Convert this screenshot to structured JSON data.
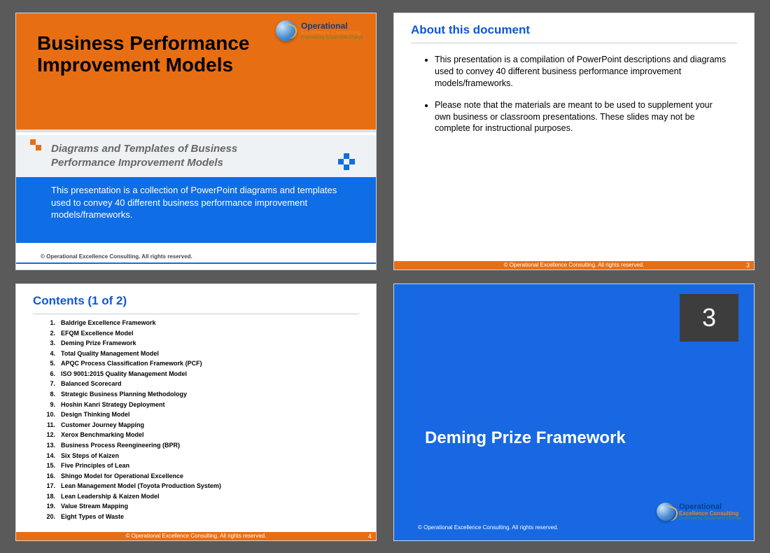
{
  "logo": {
    "line1": "Operational",
    "line2": "Excellence Consulting",
    "line3": "Empowering Sustainable Change"
  },
  "slide1": {
    "title_l1": "Business Performance",
    "title_l2": "Improvement Models",
    "subtitle": "Diagrams and Templates of Business Performance Improvement Models",
    "desc": "This presentation is a collection of PowerPoint diagrams and templates used to convey 40 different business performance improvement models/frameworks.",
    "copyright": "© Operational Excellence Consulting.  All rights reserved."
  },
  "slide2": {
    "header": "About this document",
    "bullets": [
      "This presentation is a compilation of PowerPoint descriptions and diagrams used to convey 40 different business performance improvement models/frameworks.",
      "Please note that the materials are meant to be used to supplement your own business or classroom presentations. These slides may not be complete for instructional purposes."
    ],
    "footer": "© Operational Excellence Consulting.  All rights reserved.",
    "page": "3"
  },
  "slide3": {
    "header": "Contents (1 of 2)",
    "items": [
      "Baldrige Excellence Framework",
      "EFQM Excellence Model",
      "Deming Prize Framework",
      "Total Quality Management Model",
      "APQC Process Classification Framework (PCF)",
      "ISO 9001:2015 Quality Management Model",
      "Balanced Scorecard",
      "Strategic Business Planning Methodology",
      "Hoshin Kanri Strategy Deployment",
      "Design Thinking Model",
      "Customer Journey Mapping",
      "Xerox Benchmarking Model",
      "Business Process Reengineering (BPR)",
      "Six Steps of Kaizen",
      "Five Principles of Lean",
      "Shingo Model for Operational Excellence",
      "Lean Management Model (Toyota Production System)",
      "Lean Leadership & Kaizen Model",
      "Value Stream Mapping",
      "Eight Types of Waste"
    ],
    "footer": "© Operational Excellence Consulting.  All rights reserved.",
    "page": "4"
  },
  "slide4": {
    "number": "3",
    "title": "Deming Prize Framework",
    "copyright": "© Operational Excellence Consulting.  All rights reserved."
  }
}
